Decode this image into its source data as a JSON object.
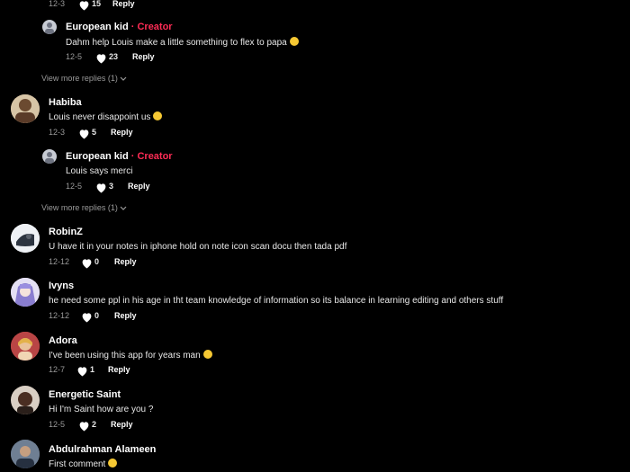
{
  "top_partial": {
    "date": "12-3",
    "likes": "15",
    "reply": "Reply"
  },
  "comments": [
    {
      "name": "European kid",
      "creator": "· Creator",
      "text": "Dahm help Louis make a little something to flex to papa",
      "date": "12-5",
      "likes": "23",
      "reply": "Reply"
    },
    {
      "name": "Habiba",
      "text": "Louis never disappoint us",
      "date": "12-3",
      "likes": "5",
      "reply": "Reply"
    },
    {
      "name": "European kid",
      "creator": "· Creator",
      "text": "Louis says merci",
      "date": "12-5",
      "likes": "3",
      "reply": "Reply"
    },
    {
      "name": "RobinZ",
      "text": "U have it in your notes in iphone hold on note icon scan docu then tada pdf",
      "date": "12-12",
      "likes": "0",
      "reply": "Reply"
    },
    {
      "name": "Ivyns",
      "text": "he need some ppl in his age in tht team knowledge of information so its balance in learning editing and others stuff",
      "date": "12-12",
      "likes": "0",
      "reply": "Reply"
    },
    {
      "name": "Adora",
      "text": "I've been using this app for years man",
      "date": "12-7",
      "likes": "1",
      "reply": "Reply"
    },
    {
      "name": "Energetic Saint",
      "text": "Hi I'm Saint how are you ?",
      "date": "12-5",
      "likes": "2",
      "reply": "Reply"
    },
    {
      "name": "Abdulrahman Alameen",
      "text": "First comment"
    }
  ],
  "view_more": [
    "View more replies (1)",
    "View more replies (1)"
  ],
  "colors": {
    "creator": "#fe2c55",
    "background": "#000000",
    "muted": "#9a9a9a"
  },
  "icons": [
    "heart-icon",
    "chevron-down-icon",
    "emoji-icon"
  ]
}
